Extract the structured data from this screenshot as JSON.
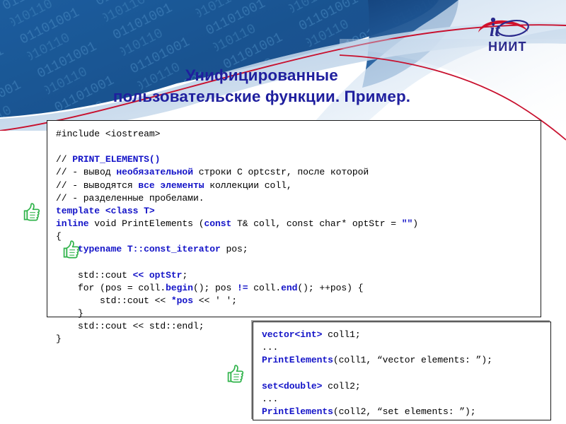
{
  "slide": {
    "title_line1": "Унифицированные",
    "title_line2": "пользовательские функции. Пример.",
    "title_color": "#1f1f9e",
    "background_color": "#ffffff"
  },
  "logo": {
    "mark_text": "it",
    "name_text": "НИИТ",
    "swoosh_color": "#d0112b",
    "name_color": "#2a2a8c",
    "accent_color": "#1a3a8f"
  },
  "header": {
    "binary_pattern_digits": "0110100101101001011010010110",
    "blue_dark": "#16528f",
    "blue_mid": "#2f6cae",
    "blue_light": "#bcd3ea",
    "arc_color": "#c8102e"
  },
  "icons": {
    "thumb_up": "thumbs-up-icon",
    "thumb_color": "#2fb34a",
    "count": 3
  },
  "code_box_1": {
    "border_color": "#1a1a1a",
    "lines": [
      [
        {
          "t": "#include <iostream>",
          "c": "blk"
        }
      ],
      [
        {
          "t": "",
          "c": "blk"
        }
      ],
      [
        {
          "t": "// ",
          "c": "blk"
        },
        {
          "t": "PRINT_ELEMENTS()",
          "c": "kw"
        }
      ],
      [
        {
          "t": "// - вывод ",
          "c": "blk"
        },
        {
          "t": "необязательной",
          "c": "kw"
        },
        {
          "t": " строки C optcstr, после которой",
          "c": "blk"
        }
      ],
      [
        {
          "t": "// - выводятся ",
          "c": "blk"
        },
        {
          "t": "все элементы",
          "c": "kw"
        },
        {
          "t": " коллекции coll,",
          "c": "blk"
        }
      ],
      [
        {
          "t": "// - разделенные пробелами.",
          "c": "blk"
        }
      ],
      [
        {
          "t": "template <class T>",
          "c": "kw"
        }
      ],
      [
        {
          "t": "inline",
          "c": "kw"
        },
        {
          "t": " void PrintElements (",
          "c": "blk"
        },
        {
          "t": "const",
          "c": "kw"
        },
        {
          "t": " T& coll, const char* optStr = ",
          "c": "blk"
        },
        {
          "t": "\"\"",
          "c": "kw"
        },
        {
          "t": ")",
          "c": "blk"
        }
      ],
      [
        {
          "t": "{",
          "c": "blk"
        }
      ],
      [
        {
          "t": "    ",
          "c": "blk"
        },
        {
          "t": "typename T::const_iterator",
          "c": "kw"
        },
        {
          "t": " pos;",
          "c": "blk"
        }
      ],
      [
        {
          "t": "",
          "c": "blk"
        }
      ],
      [
        {
          "t": "    std::cout ",
          "c": "blk"
        },
        {
          "t": "<< optStr",
          "c": "kw"
        },
        {
          "t": ";",
          "c": "blk"
        }
      ],
      [
        {
          "t": "    for (pos = coll.",
          "c": "blk"
        },
        {
          "t": "begin",
          "c": "kw"
        },
        {
          "t": "(); pos ",
          "c": "blk"
        },
        {
          "t": "!=",
          "c": "kw"
        },
        {
          "t": " coll.",
          "c": "blk"
        },
        {
          "t": "end",
          "c": "kw"
        },
        {
          "t": "(); ++pos) {",
          "c": "blk"
        }
      ],
      [
        {
          "t": "        std::cout << ",
          "c": "blk"
        },
        {
          "t": "*pos",
          "c": "kw"
        },
        {
          "t": " << ' ';",
          "c": "blk"
        }
      ],
      [
        {
          "t": "    }",
          "c": "blk"
        }
      ],
      [
        {
          "t": "    std::cout << std::endl;",
          "c": "blk"
        }
      ],
      [
        {
          "t": "}",
          "c": "blk"
        }
      ]
    ]
  },
  "code_box_2": {
    "border_color": "#1a1a1a",
    "shadow_color": "#9a9a9a",
    "lines": [
      [
        {
          "t": "vector<int>",
          "c": "kw"
        },
        {
          "t": " coll1;",
          "c": "blk"
        }
      ],
      [
        {
          "t": "...",
          "c": "blk"
        }
      ],
      [
        {
          "t": "PrintElements",
          "c": "kw"
        },
        {
          "t": "(coll1, “vector elements: ”);",
          "c": "blk"
        }
      ],
      [
        {
          "t": "",
          "c": "blk"
        }
      ],
      [
        {
          "t": "set<double>",
          "c": "kw"
        },
        {
          "t": " coll2;",
          "c": "blk"
        }
      ],
      [
        {
          "t": "...",
          "c": "blk"
        }
      ],
      [
        {
          "t": "PrintElements",
          "c": "kw"
        },
        {
          "t": "(coll2, “set elements: ”);",
          "c": "blk"
        }
      ]
    ]
  }
}
